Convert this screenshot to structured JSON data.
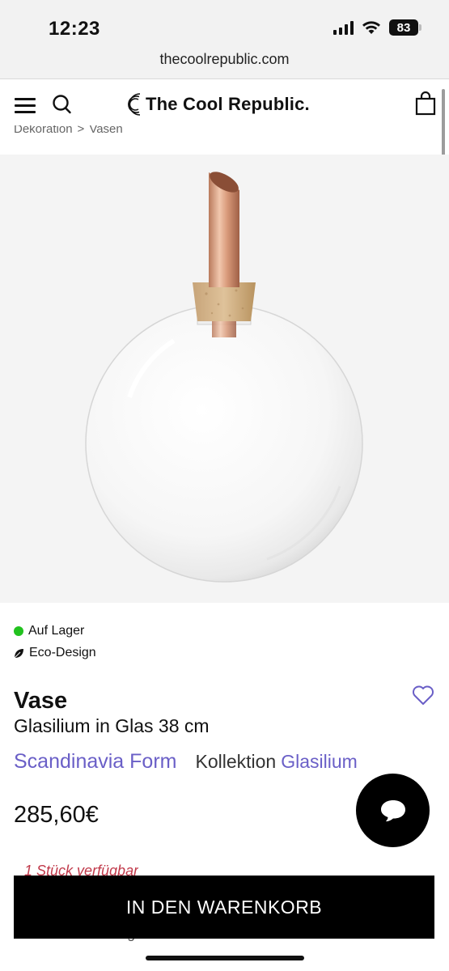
{
  "status_bar": {
    "time": "12:23",
    "battery": "83"
  },
  "browser": {
    "url": "thecoolrepublic.com"
  },
  "header": {
    "logo_text": "The Cool Republic."
  },
  "breadcrumb": {
    "items": [
      "Dekoration",
      "Vasen"
    ],
    "separator": ">"
  },
  "product": {
    "stock_status": "Auf Lager",
    "stock_color": "#22c21f",
    "eco_label": "Eco-Design",
    "title": "Vase",
    "subtitle": "Glasilium in Glas 38 cm",
    "brand": "Scandinavia Form",
    "collection_label": "Kollektion",
    "collection_name": "Glasilium",
    "price": "285,60€",
    "availability": "1 Stück verfügbar",
    "installment": "0% Raten-Zahlung ohne Gebühren",
    "add_to_cart_label": "IN DEN WARENKORB",
    "link_color": "#6a5fc7"
  },
  "icons": {
    "menu": "menu-icon",
    "search": "search-icon",
    "cart": "shopping-bag-icon",
    "wishlist": "heart-icon",
    "chat": "chat-bubble-icon",
    "eco": "leaf-icon"
  }
}
